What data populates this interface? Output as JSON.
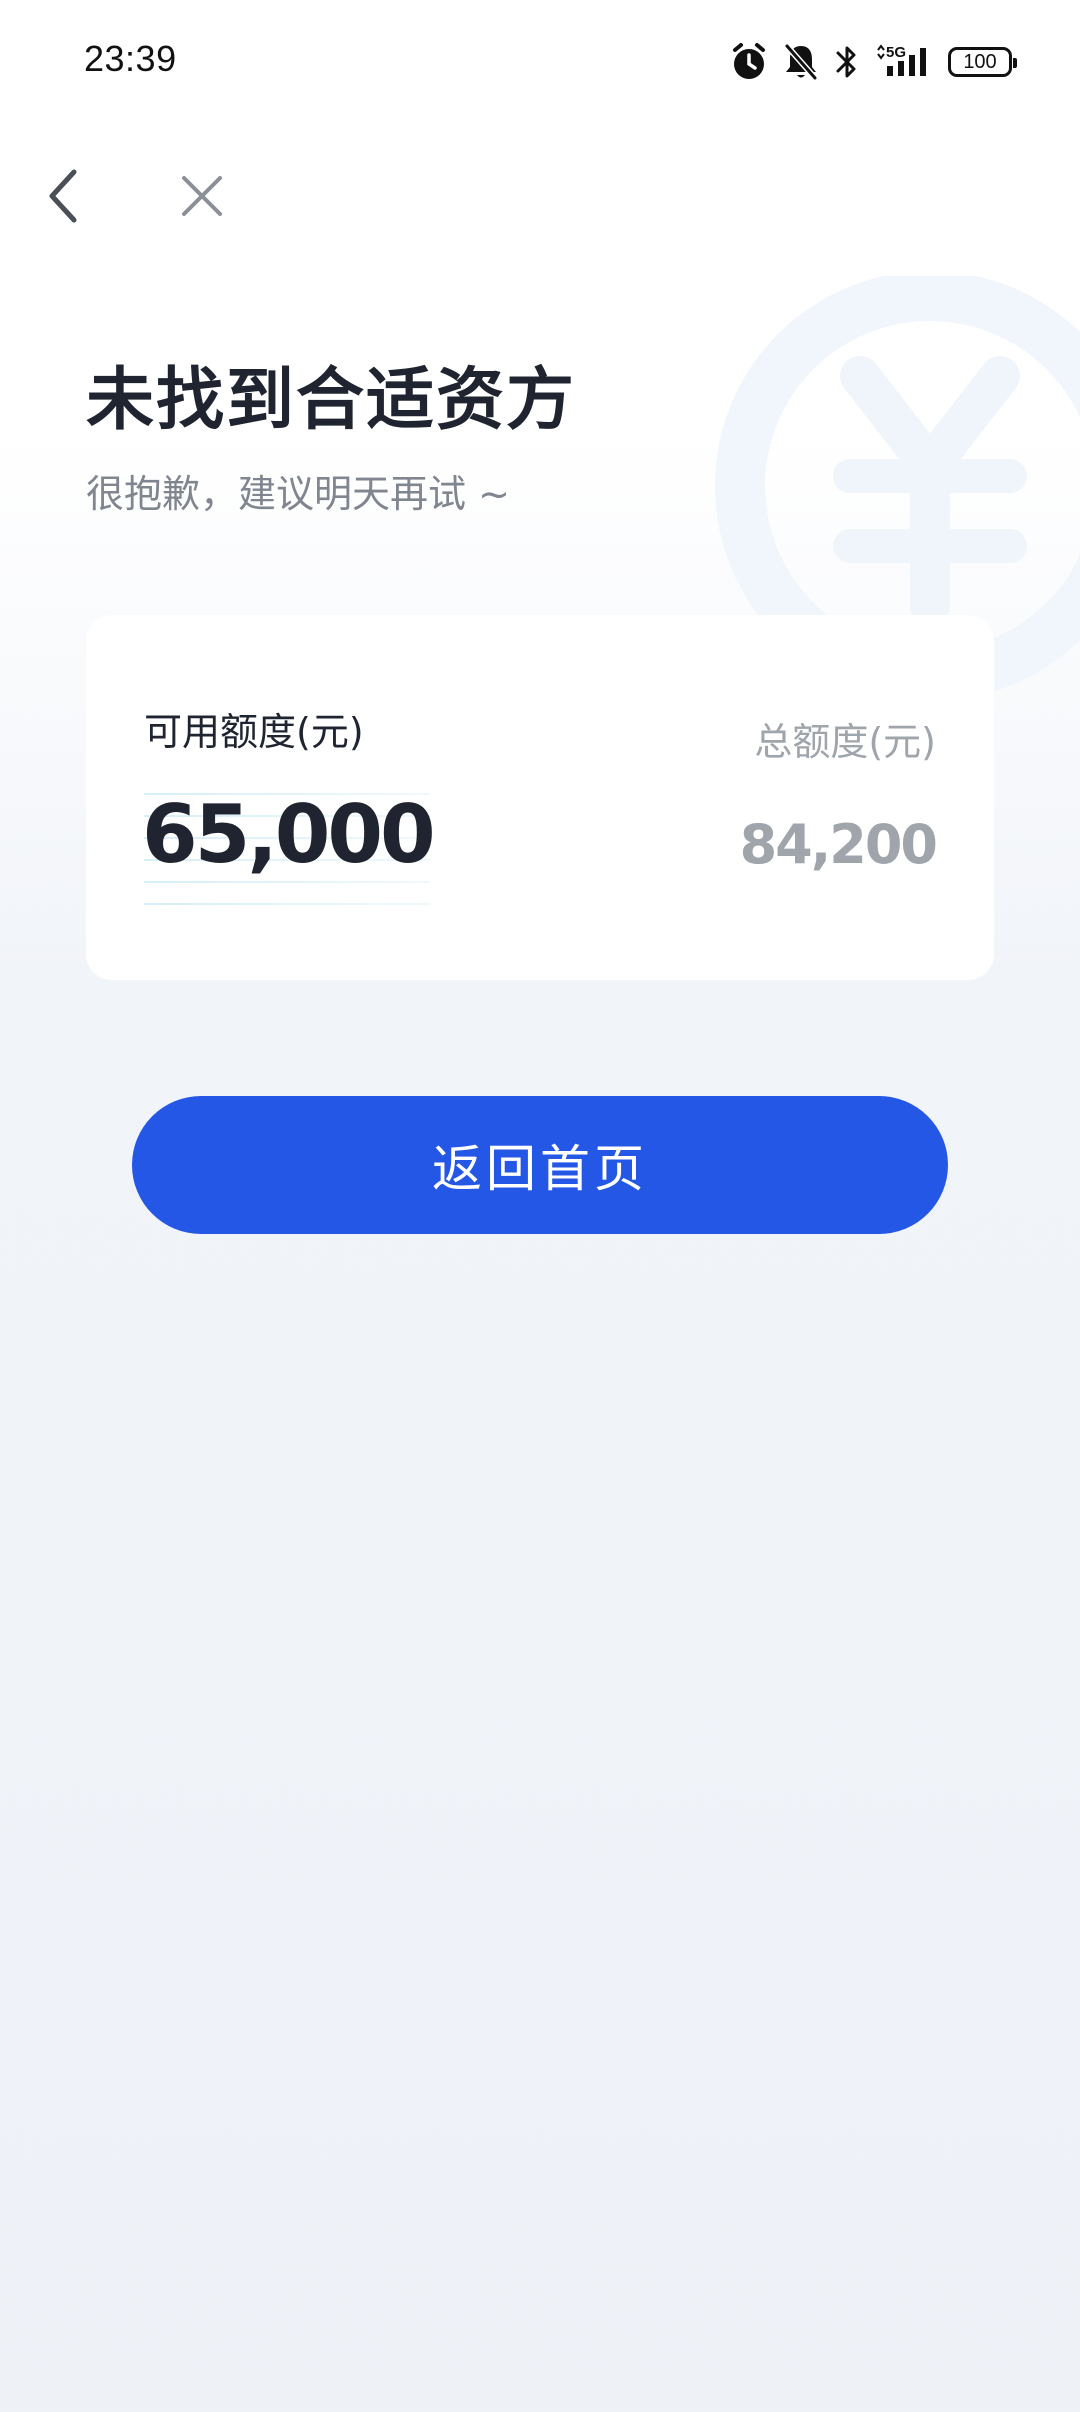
{
  "status_bar": {
    "time": "23:39",
    "network_label": "5G",
    "battery_level": "100",
    "icons": [
      "alarm-icon",
      "bell-off-icon",
      "bluetooth-icon",
      "signal-5g-icon",
      "battery-icon"
    ]
  },
  "nav": {
    "back_icon": "chevron-left-icon",
    "close_icon": "close-icon"
  },
  "header": {
    "title": "未找到合适资方",
    "subtitle": "很抱歉，建议明天再试 ~"
  },
  "credit_card": {
    "available_label": "可用额度(元)",
    "available_value": "65,000",
    "total_label": "总额度(元)",
    "total_value": "84,200"
  },
  "actions": {
    "home_button_label": "返回首页"
  },
  "colors": {
    "primary": "#2457e6",
    "text_dark": "#1f2430",
    "text_muted": "#80858f",
    "text_light": "#a0a4ab",
    "background": "#eef2f7"
  }
}
